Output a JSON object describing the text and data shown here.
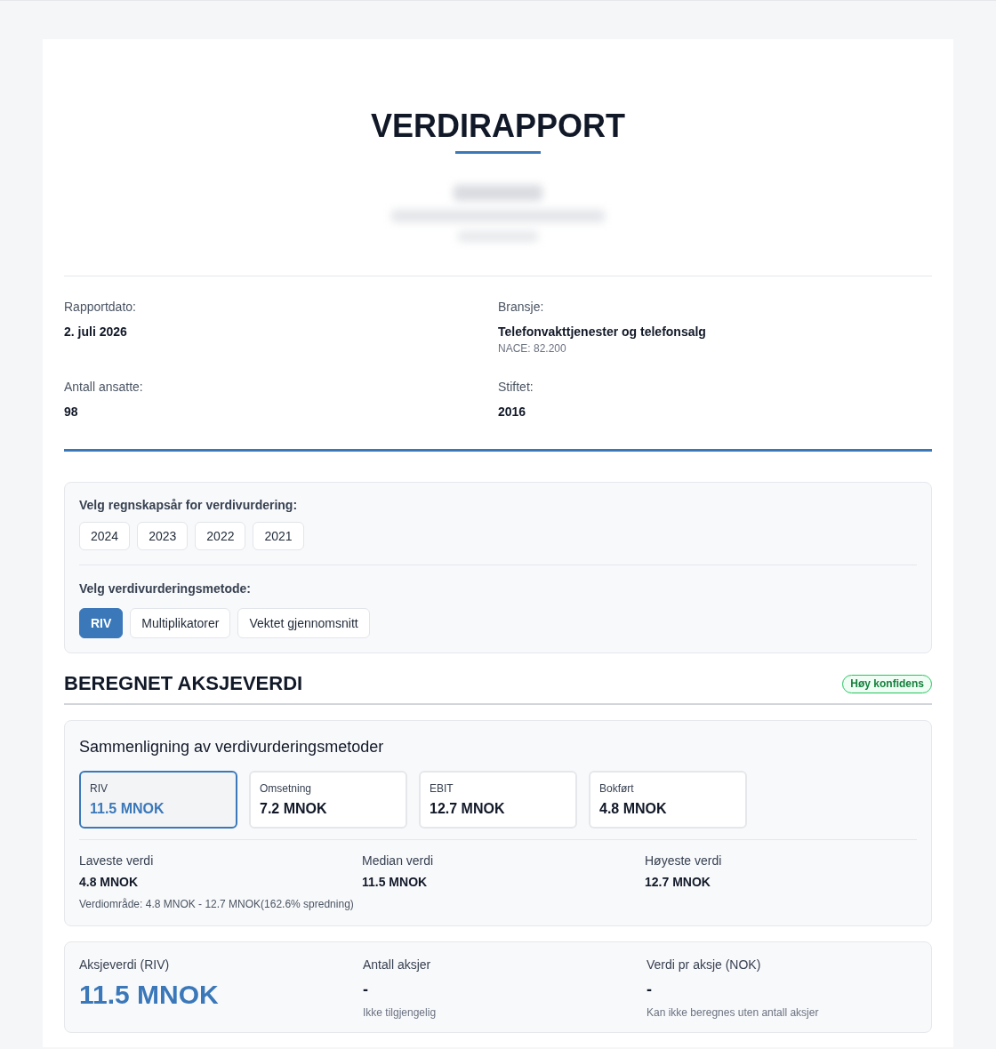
{
  "report": {
    "title": "VERDIRAPPORT"
  },
  "info": [
    {
      "label": "Rapportdato:",
      "value": "2. juli 2026"
    },
    {
      "label": "Bransje:",
      "value": "Telefonvakttjenester og telefonsalg",
      "note": "NACE: 82.200"
    },
    {
      "label": "Antall ansatte:",
      "value": "98"
    },
    {
      "label": "Stiftet:",
      "value": "2016"
    }
  ],
  "year_selector": {
    "label": "Velg regnskapsår for verdivurdering:",
    "options": [
      {
        "label": "2024",
        "selected": false
      },
      {
        "label": "2023",
        "selected": false
      },
      {
        "label": "2022",
        "selected": false
      },
      {
        "label": "2021",
        "selected": false
      }
    ]
  },
  "method_selector": {
    "label": "Velg verdivurderingsmetode:",
    "options": [
      {
        "label": "RIV",
        "selected": true
      },
      {
        "label": "Multiplikatorer",
        "selected": false
      },
      {
        "label": "Vektet gjennomsnitt",
        "selected": false
      }
    ]
  },
  "valuation_section": {
    "title": "BEREGNET AKSJEVERDI",
    "confidence_badge": "Høy konfidens"
  },
  "comparison": {
    "title": "Sammenligning av verdivurderingsmetoder",
    "methods": [
      {
        "label": "RIV",
        "value": "11.5 MNOK",
        "selected": true
      },
      {
        "label": "Omsetning",
        "value": "7.2 MNOK",
        "selected": false
      },
      {
        "label": "EBIT",
        "value": "12.7 MNOK",
        "selected": false
      },
      {
        "label": "Bokført",
        "value": "4.8 MNOK",
        "selected": false
      }
    ],
    "stats": [
      {
        "label": "Laveste verdi",
        "value": "4.8 MNOK"
      },
      {
        "label": "Median verdi",
        "value": "11.5 MNOK"
      },
      {
        "label": "Høyeste verdi",
        "value": "12.7 MNOK"
      }
    ],
    "range_note": "Verdiområde: 4.8 MNOK - 12.7 MNOK(162.6% spredning)"
  },
  "summary": [
    {
      "kind": "highlight",
      "label": "Aksjeverdi (RIV)",
      "value": "11.5 MNOK"
    },
    {
      "kind": "plain",
      "label": "Antall aksjer",
      "value": "-",
      "note": "Ikke tilgjengelig"
    },
    {
      "kind": "plain",
      "label": "Verdi pr aksje (NOK)",
      "value": "-",
      "note": "Kan ikke beregnes uten antall aksjer"
    }
  ]
}
